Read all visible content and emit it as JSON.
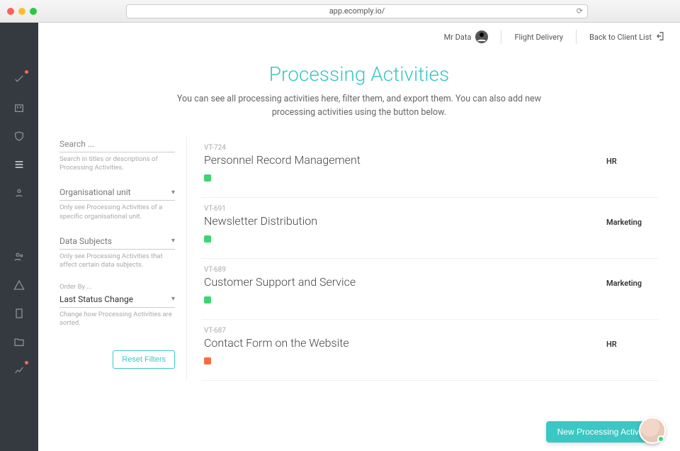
{
  "browser": {
    "url": "app.ecomply.io/"
  },
  "topbar": {
    "user_label": "Mr Data",
    "client_label": "Flight Delivery",
    "back_label": "Back to Client List"
  },
  "page": {
    "title": "Processing Activities",
    "subtitle": "You can see all processing activities here, filter them, and export them. You can also add new processing activities using the button below."
  },
  "filters": {
    "search": {
      "placeholder": "Search ...",
      "hint": "Search in titles or descriptions of Processing Activities."
    },
    "org_unit": {
      "label": "Organisational unit",
      "hint": "Only see Processing Activities of a specific organisational unit."
    },
    "data_subjects": {
      "label": "Data Subjects",
      "hint": "Only see Processing Activities that affect certain data subjects."
    },
    "order_by": {
      "top_label": "Order By ...",
      "value": "Last Status Change",
      "hint": "Change how Processing Activities are sorted."
    },
    "reset_label": "Reset Filters"
  },
  "activities": [
    {
      "code": "VT-724",
      "title": "Personnel Record Management",
      "status_color": "#3bd671",
      "dept": "HR"
    },
    {
      "code": "VT-691",
      "title": "Newsletter Distribution",
      "status_color": "#3bd671",
      "dept": "Marketing"
    },
    {
      "code": "VT-689",
      "title": "Customer Support and Service",
      "status_color": "#3bd671",
      "dept": "Marketing"
    },
    {
      "code": "VT-687",
      "title": "Contact Form on the Website",
      "status_color": "#ff6a3d",
      "dept": "HR"
    }
  ],
  "actions": {
    "new_label": "New Processing Activity"
  },
  "sidebar": {
    "items": [
      {
        "name": "tasks-icon",
        "notif": true
      },
      {
        "name": "company-icon",
        "notif": false
      },
      {
        "name": "shield-icon",
        "notif": false
      },
      {
        "name": "list-icon",
        "notif": false,
        "active": true
      },
      {
        "name": "people-icon",
        "notif": false
      }
    ],
    "items2": [
      {
        "name": "users-icon",
        "notif": false
      },
      {
        "name": "warning-icon",
        "notif": false
      },
      {
        "name": "doc-icon",
        "notif": false
      },
      {
        "name": "folder-icon",
        "notif": false
      },
      {
        "name": "chart-icon",
        "notif": true
      }
    ]
  }
}
